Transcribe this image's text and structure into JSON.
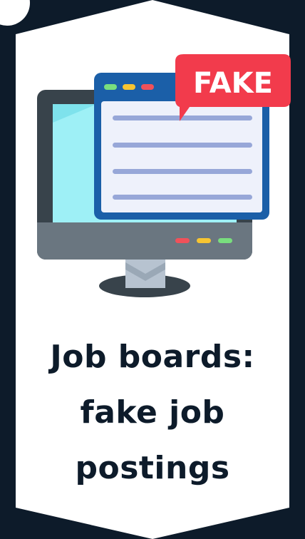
{
  "badge": {
    "label": "FAKE"
  },
  "headline": {
    "line1": "Job boards:",
    "line2": "fake job",
    "line3": "postings"
  },
  "colors": {
    "background": "#0d1b2a",
    "card": "#ffffff",
    "badge": "#f23b4c",
    "window_border": "#1b5fa8",
    "window_body": "#eef1fb",
    "text_lines": "#97a7d8",
    "screen": "#9ef0f6",
    "monitor_frame": "#38434b",
    "monitor_base": "#6a7680",
    "stand": "#b7c3d0",
    "dot_red": "#f0515a",
    "dot_yellow": "#f7c531",
    "dot_green": "#79de7e"
  },
  "icons": {
    "illustration": "computer-monitor-fake-job-window-icon"
  }
}
